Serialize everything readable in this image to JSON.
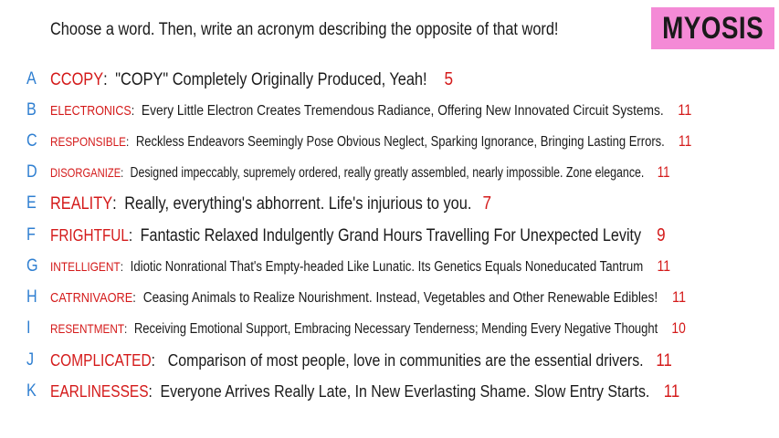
{
  "instruction": "Choose a word. Then, write an acronym describing the opposite of that word!",
  "badge": "MYOSIS",
  "rows": [
    {
      "letter": "A",
      "word": "CCOPY",
      "text": "\"COPY\" Completely Originally Produced, Yeah!",
      "count": "5"
    },
    {
      "letter": "B",
      "word": "ELECTRONICS",
      "text": "Every Little Electron Creates Tremendous Radiance, Offering New Innovated Circuit Systems.",
      "count": "11"
    },
    {
      "letter": "C",
      "word": "RESPONSIBLE",
      "text": "Reckless Endeavors Seemingly Pose Obvious Neglect, Sparking Ignorance, Bringing Lasting Errors.",
      "count": "11"
    },
    {
      "letter": "D",
      "word": "DISORGANIZE",
      "text": "Designed impeccably, supremely ordered, really greatly assembled, nearly impossible. Zone elegance.",
      "count": "11"
    },
    {
      "letter": "E",
      "word": "REALITY",
      "text": "Really, everything's abhorrent. Life's injurious to you.",
      "count": "7"
    },
    {
      "letter": "F",
      "word": "FRIGHTFUL",
      "text": "Fantastic Relaxed Indulgently Grand Hours Travelling For Unexpected Levity",
      "count": "9"
    },
    {
      "letter": "G",
      "word": "INTELLIGENT",
      "text": "Idiotic Nonrational That's Empty-headed Like Lunatic. Its Genetics Equals Noneducated Tantrum",
      "count": "11"
    },
    {
      "letter": "H",
      "word": "CATRNIVAORE",
      "text": "Ceasing Animals to Realize Nourishment. Instead, Vegetables and Other Renewable Edibles!",
      "count": "11"
    },
    {
      "letter": "I",
      "word": "RESENTMENT",
      "text": "Receiving Emotional Support, Embracing Necessary Tenderness; Mending Every Negative Thought",
      "count": "10"
    },
    {
      "letter": "J",
      "word": "COMPLICATED",
      "text": "Comparison of most people, love in communities are the essential drivers.",
      "count": "11"
    },
    {
      "letter": "K",
      "word": "EARLINESSES",
      "text": "Everyone Arrives Really Late, In New Everlasting Shame. Slow Entry Starts.",
      "count": "11"
    }
  ]
}
